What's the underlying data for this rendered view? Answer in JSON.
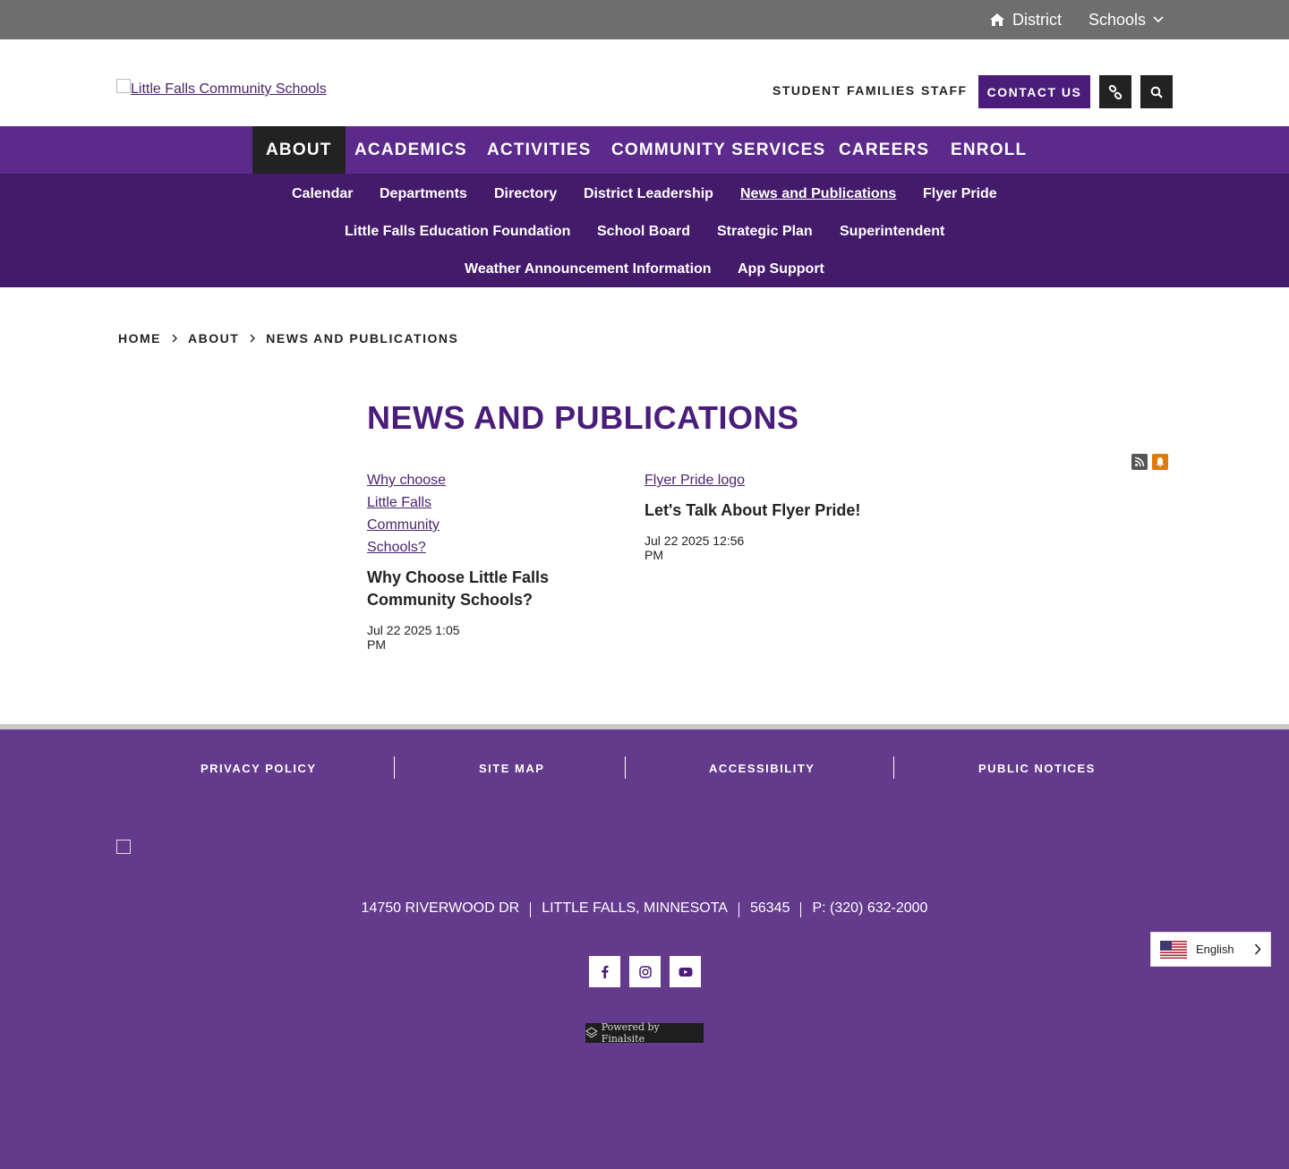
{
  "utility_bar": {
    "district_label": "District",
    "schools_label": "Schools"
  },
  "header": {
    "logo_alt": "Little Falls Community Schools",
    "audience_links": [
      "STUDENT",
      "FAMILIES",
      "STAFF"
    ],
    "contact_label": "CONTACT US"
  },
  "main_nav": {
    "items": [
      "ABOUT",
      "ACADEMICS",
      "ACTIVITIES",
      "COMMUNITY SERVICES",
      "CAREERS",
      "ENROLL"
    ],
    "active": "ABOUT"
  },
  "sub_nav": {
    "items": [
      "Calendar",
      "Departments",
      "Directory",
      "District Leadership",
      "News and Publications",
      "Flyer Pride",
      "Little Falls Education Foundation",
      "School Board",
      "Strategic Plan",
      "Superintendent",
      "Weather Announcement Information",
      "App Support"
    ],
    "current": "News and Publications"
  },
  "breadcrumb": [
    "HOME",
    "ABOUT",
    "NEWS AND PUBLICATIONS"
  ],
  "page_title": "NEWS AND PUBLICATIONS",
  "posts": [
    {
      "image_alt": "Why choose Little Falls Community Schools?",
      "title": "Why Choose Little Falls Community Schools?",
      "date": "Jul 22 2025 1:05 PM"
    },
    {
      "image_alt": "Flyer Pride logo",
      "title": "Let's Talk About Flyer Pride!",
      "date": "Jul 22 2025 12:56 PM"
    }
  ],
  "footer": {
    "links": [
      "PRIVACY POLICY",
      "SITE MAP",
      "ACCESSIBILITY",
      "PUBLIC NOTICES"
    ],
    "address": {
      "street": "14750 RIVERWOOD DR",
      "city_state": "LITTLE FALLS, MINNESOTA",
      "zip": "56345",
      "phone": "P: (320) 632-2000"
    },
    "social": [
      "facebook-icon",
      "instagram-icon",
      "youtube-icon"
    ],
    "powered_by": "Powered by Finalsite"
  },
  "language": {
    "label": "English"
  },
  "colors": {
    "utility_bar": "#6e6e6e",
    "primary_purple": "#5b2a8c",
    "sub_nav_purple": "#441a6b",
    "footer_purple": "#643a8c",
    "title_purple": "#4a1d7a",
    "bell_orange": "#e07b0a"
  }
}
